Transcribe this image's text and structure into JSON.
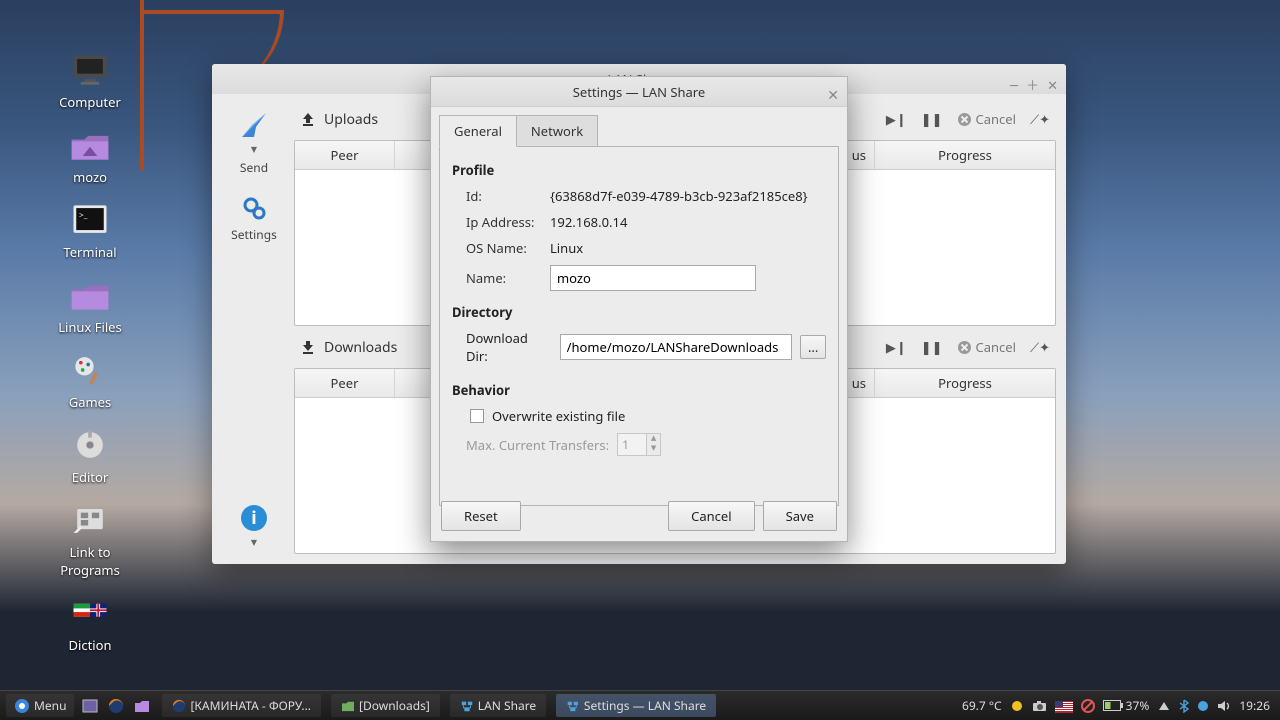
{
  "desktop": {
    "icons": [
      {
        "label": "Computer"
      },
      {
        "label": "mozo"
      },
      {
        "label": "Terminal"
      },
      {
        "label": "Linux Files"
      },
      {
        "label": "Games"
      },
      {
        "label": "Editor"
      },
      {
        "label": "Link to Programs"
      },
      {
        "label": "Diction"
      }
    ]
  },
  "app": {
    "title": "LAN Share",
    "nav": {
      "send": "Send",
      "settings": "Settings"
    },
    "uploads_label": "Uploads",
    "downloads_label": "Downloads",
    "columns": {
      "peer": "Peer",
      "status_partial": "us",
      "progress": "Progress"
    },
    "cancel_label": "Cancel"
  },
  "dialog": {
    "title": "Settings — LAN Share",
    "tabs": {
      "general": "General",
      "network": "Network"
    },
    "profile": {
      "heading": "Profile",
      "id_label": "Id:",
      "id_value": "{63868d7f-e039-4789-b3cb-923af2185ce8}",
      "ip_label": "Ip Address:",
      "ip_value": "192.168.0.14",
      "os_label": "OS Name:",
      "os_value": "Linux",
      "name_label": "Name:",
      "name_value": "mozo"
    },
    "directory": {
      "heading": "Directory",
      "download_label": "Download Dir:",
      "download_value": "/home/mozo/LANShareDownloads",
      "browse": "..."
    },
    "behavior": {
      "heading": "Behavior",
      "overwrite": "Overwrite existing file",
      "max_transfers_label": "Max. Current Transfers:",
      "max_transfers_value": "1"
    },
    "buttons": {
      "reset": "Reset",
      "cancel": "Cancel",
      "save": "Save"
    }
  },
  "taskbar": {
    "menu": "Menu",
    "tasks": [
      {
        "label": "[КАМИНАТА - ФОРУ..."
      },
      {
        "label": "[Downloads]"
      },
      {
        "label": "LAN Share"
      },
      {
        "label": "Settings — LAN Share"
      }
    ],
    "temp": "69.7 °C",
    "battery": "37%",
    "clock": "19:26"
  }
}
